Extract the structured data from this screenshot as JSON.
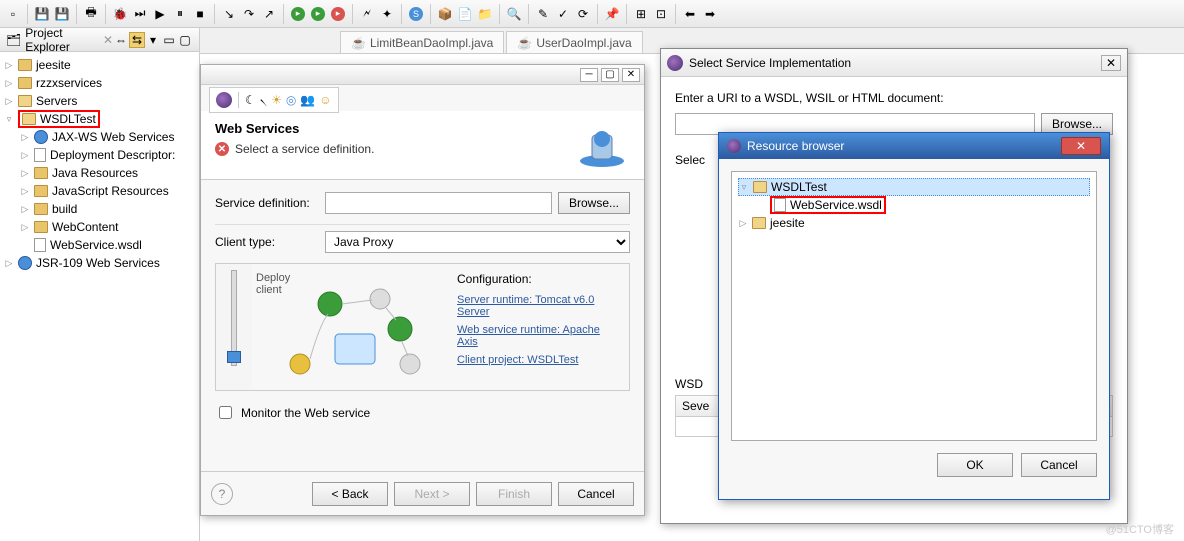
{
  "toolbar_icons": [
    "new",
    "save",
    "save-all",
    "print",
    "build",
    "debug",
    "run",
    "stop",
    "step",
    "resume",
    "run-dd",
    "debug-dd",
    "ext-tools",
    "new-wiz",
    "search",
    "refresh",
    "sync",
    "annotate",
    "task",
    "pkg",
    "type",
    "nav-back",
    "nav-fwd"
  ],
  "project_explorer": {
    "title": "Project Explorer",
    "items": [
      {
        "label": "jeesite",
        "indent": 0,
        "exp": "▷",
        "icon": "folder"
      },
      {
        "label": "rzzxservices",
        "indent": 0,
        "exp": "▷",
        "icon": "folder"
      },
      {
        "label": "Servers",
        "indent": 0,
        "exp": "▷",
        "icon": "folder-open"
      },
      {
        "label": "WSDLTest",
        "indent": 0,
        "exp": "▿",
        "icon": "folder-open",
        "highlight": true
      },
      {
        "label": "JAX-WS Web Services",
        "indent": 1,
        "exp": "▷",
        "icon": "svc"
      },
      {
        "label": "Deployment Descriptor:",
        "indent": 1,
        "exp": "▷",
        "icon": "file"
      },
      {
        "label": "Java Resources",
        "indent": 1,
        "exp": "▷",
        "icon": "folder"
      },
      {
        "label": "JavaScript Resources",
        "indent": 1,
        "exp": "▷",
        "icon": "folder"
      },
      {
        "label": "build",
        "indent": 1,
        "exp": "▷",
        "icon": "folder"
      },
      {
        "label": "WebContent",
        "indent": 1,
        "exp": "▷",
        "icon": "folder"
      },
      {
        "label": "WebService.wsdl",
        "indent": 1,
        "exp": "",
        "icon": "file"
      },
      {
        "label": "JSR-109 Web Services",
        "indent": 0,
        "exp": "▷",
        "icon": "svc"
      }
    ]
  },
  "tabs": [
    {
      "label": "LimitBeanDaoImpl.java"
    },
    {
      "label": "UserDaoImpl.java"
    }
  ],
  "wizard": {
    "title": "Web Services",
    "message": "Select a service definition.",
    "service_def_label": "Service definition:",
    "browse": "Browse...",
    "client_type_label": "Client type:",
    "client_type_value": "Java Proxy",
    "deploy_label": "Deploy client",
    "config_title": "Configuration:",
    "cfg_links": [
      "Server runtime: Tomcat v6.0 Server",
      "Web service runtime: Apache Axis",
      "Client project: WSDLTest"
    ],
    "monitor": "Monitor the Web service",
    "back": "< Back",
    "next": "Next >",
    "finish": "Finish",
    "cancel": "Cancel"
  },
  "dialog2": {
    "title": "Select Service Implementation",
    "prompt": "Enter a URI to a WSDL, WSIL or HTML document:",
    "browse": "Browse...",
    "select_label": "Selec",
    "wsd_label": "WSD",
    "severity_col": "Seve"
  },
  "dialog3": {
    "title": "Resource browser",
    "tree": [
      {
        "label": "WSDLTest",
        "indent": 1,
        "exp": "▿",
        "icon": "folder-open",
        "selected": true
      },
      {
        "label": "WebService.wsdl",
        "indent": 2,
        "exp": "",
        "icon": "file",
        "highlight": true
      },
      {
        "label": "jeesite",
        "indent": 1,
        "exp": "▷",
        "icon": "folder"
      }
    ],
    "ok": "OK",
    "cancel": "Cancel"
  },
  "watermark": "@51CTO博客"
}
